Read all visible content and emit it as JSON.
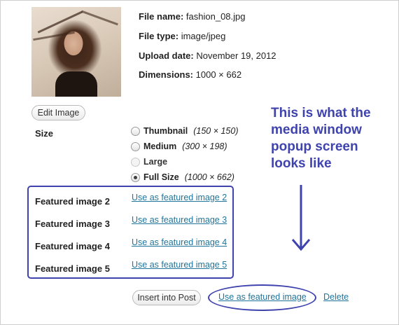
{
  "meta": {
    "file_name_label": "File name:",
    "file_name": "fashion_08.jpg",
    "file_type_label": "File type:",
    "file_type": "image/jpeg",
    "upload_date_label": "Upload date:",
    "upload_date": "November 19, 2012",
    "dimensions_label": "Dimensions:",
    "dimensions": "1000 × 662"
  },
  "edit_image_label": "Edit Image",
  "size": {
    "label": "Size",
    "options": [
      {
        "label": "Thumbnail",
        "dims": "(150 × 150)",
        "checked": false,
        "disabled": false
      },
      {
        "label": "Medium",
        "dims": "(300 × 198)",
        "checked": false,
        "disabled": false
      },
      {
        "label": "Large",
        "dims": "",
        "checked": false,
        "disabled": true
      },
      {
        "label": "Full Size",
        "dims": "(1000 × 662)",
        "checked": true,
        "disabled": false
      }
    ]
  },
  "featured": [
    {
      "label": "Featured image 2",
      "link": "Use as featured image 2"
    },
    {
      "label": "Featured image 3",
      "link": "Use as featured image 3"
    },
    {
      "label": "Featured image 4",
      "link": "Use as featured image 4"
    },
    {
      "label": "Featured image 5",
      "link": "Use as featured image 5"
    }
  ],
  "annotation": "This is what the media window popup screen looks like",
  "actions": {
    "insert_label": "Insert into Post",
    "use_featured_label": "Use as featured image",
    "delete_label": "Delete"
  },
  "colors": {
    "annotation": "#3f43ad",
    "link": "#21759b"
  }
}
